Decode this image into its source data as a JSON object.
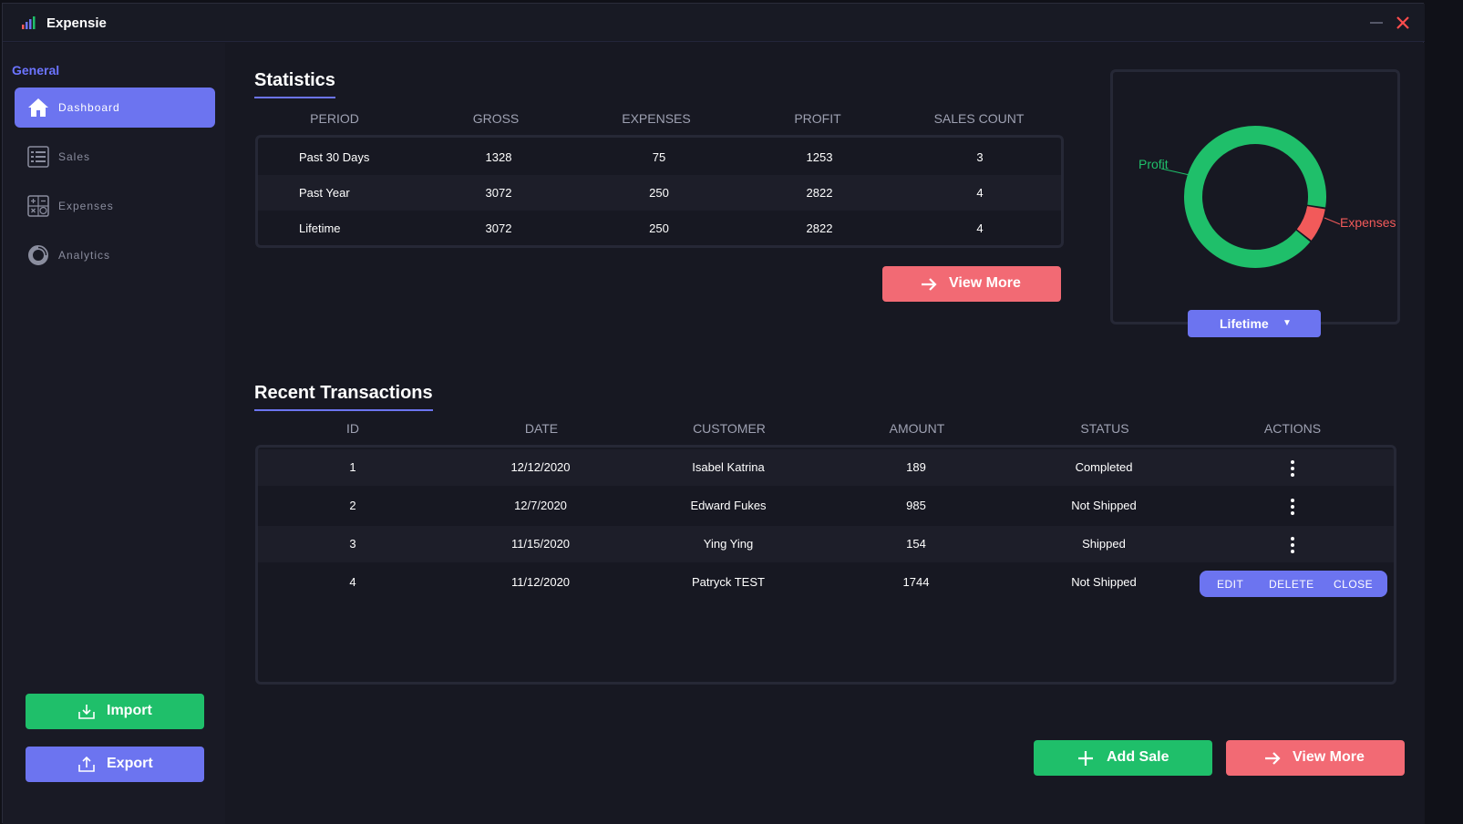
{
  "app": {
    "title": "Expensie"
  },
  "sidebar": {
    "heading": "General",
    "items": [
      {
        "label": "Dashboard",
        "icon": "home-icon"
      },
      {
        "label": "Sales",
        "icon": "list-icon"
      },
      {
        "label": "Expenses",
        "icon": "calculator-icon"
      },
      {
        "label": "Analytics",
        "icon": "donut-chart-icon"
      }
    ],
    "import_label": "Import",
    "export_label": "Export"
  },
  "statistics": {
    "title": "Statistics",
    "columns": [
      "PERIOD",
      "GROSS",
      "EXPENSES",
      "PROFIT",
      "SALES COUNT"
    ],
    "rows": [
      {
        "period": "Past 30 Days",
        "gross": "1328",
        "expenses": "75",
        "profit": "1253",
        "sales_count": "3"
      },
      {
        "period": "Past Year",
        "gross": "3072",
        "expenses": "250",
        "profit": "2822",
        "sales_count": "4"
      },
      {
        "period": "Lifetime",
        "gross": "3072",
        "expenses": "250",
        "profit": "2822",
        "sales_count": "4"
      }
    ],
    "view_more_label": "View More"
  },
  "donut": {
    "profit_label": "Profit",
    "expenses_label": "Expenses",
    "profit_value": 2822,
    "expenses_value": 250,
    "profit_color": "#1fbf6a",
    "expenses_color": "#f25a5a",
    "period_selected": "Lifetime"
  },
  "transactions": {
    "title": "Recent Transactions",
    "columns": [
      "ID",
      "DATE",
      "CUSTOMER",
      "AMOUNT",
      "STATUS",
      "ACTIONS"
    ],
    "rows": [
      {
        "id": "1",
        "date": "12/12/2020",
        "customer": "Isabel Katrina",
        "amount": "189",
        "status": "Completed"
      },
      {
        "id": "2",
        "date": "12/7/2020",
        "customer": "Edward Fukes",
        "amount": "985",
        "status": "Not Shipped"
      },
      {
        "id": "3",
        "date": "11/15/2020",
        "customer": "Ying Ying",
        "amount": "154",
        "status": "Shipped"
      },
      {
        "id": "4",
        "date": "11/12/2020",
        "customer": "Patryck TEST",
        "amount": "1744",
        "status": "Not Shipped"
      }
    ],
    "action_menu": {
      "edit": "EDIT",
      "delete": "DELETE",
      "close": "CLOSE"
    },
    "add_sale_label": "Add Sale",
    "view_more_label": "View More"
  },
  "colors": {
    "accent": "#6c74f0",
    "green": "#1fbf6a",
    "red": "#f26a74",
    "background": "#171822"
  }
}
